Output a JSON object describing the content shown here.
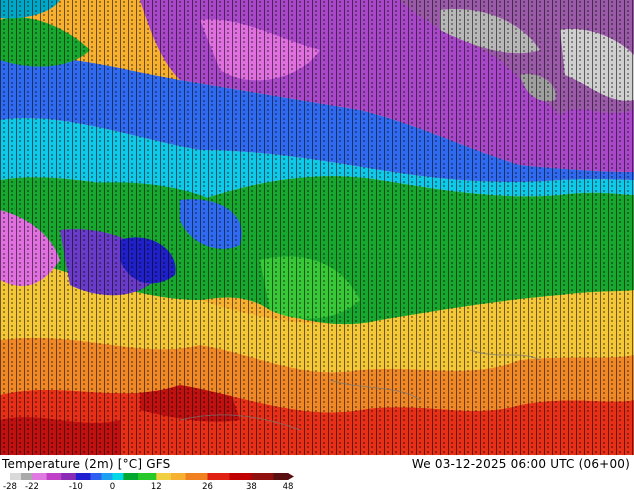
{
  "map": {
    "product": "Temperature (2m) [°C]",
    "model": "GFS",
    "valid_time": "We 03-12-2025 06:00 UTC (06+00)"
  },
  "legend": {
    "tick_labels": [
      "-28",
      "-22",
      "-10",
      "0",
      "12",
      "26",
      "38",
      "48"
    ],
    "tick_values": [
      -28,
      -22,
      -10,
      0,
      12,
      26,
      38,
      48
    ],
    "colors": [
      {
        "from": -28,
        "to": -25,
        "color": "#d9d9d9"
      },
      {
        "from": -25,
        "to": -22,
        "color": "#a9a9a9"
      },
      {
        "from": -22,
        "to": -18,
        "color": "#e07ae0"
      },
      {
        "from": -18,
        "to": -14,
        "color": "#c040c8"
      },
      {
        "from": -14,
        "to": -10,
        "color": "#8a2bb8"
      },
      {
        "from": -10,
        "to": -6,
        "color": "#2020d0"
      },
      {
        "from": -6,
        "to": -3,
        "color": "#2f5ff0"
      },
      {
        "from": -3,
        "to": 0,
        "color": "#1ea0f0"
      },
      {
        "from": 0,
        "to": 3,
        "color": "#00d8e8"
      },
      {
        "from": 3,
        "to": 7,
        "color": "#00a830"
      },
      {
        "from": 7,
        "to": 12,
        "color": "#28c828"
      },
      {
        "from": 12,
        "to": 16,
        "color": "#f0d040"
      },
      {
        "from": 16,
        "to": 20,
        "color": "#f8b030"
      },
      {
        "from": 20,
        "to": 26,
        "color": "#f08020"
      },
      {
        "from": 26,
        "to": 32,
        "color": "#e02010"
      },
      {
        "from": 32,
        "to": 38,
        "color": "#c00000"
      },
      {
        "from": 38,
        "to": 44,
        "color": "#901010"
      },
      {
        "from": 44,
        "to": 48,
        "color": "#5a1010"
      }
    ]
  }
}
